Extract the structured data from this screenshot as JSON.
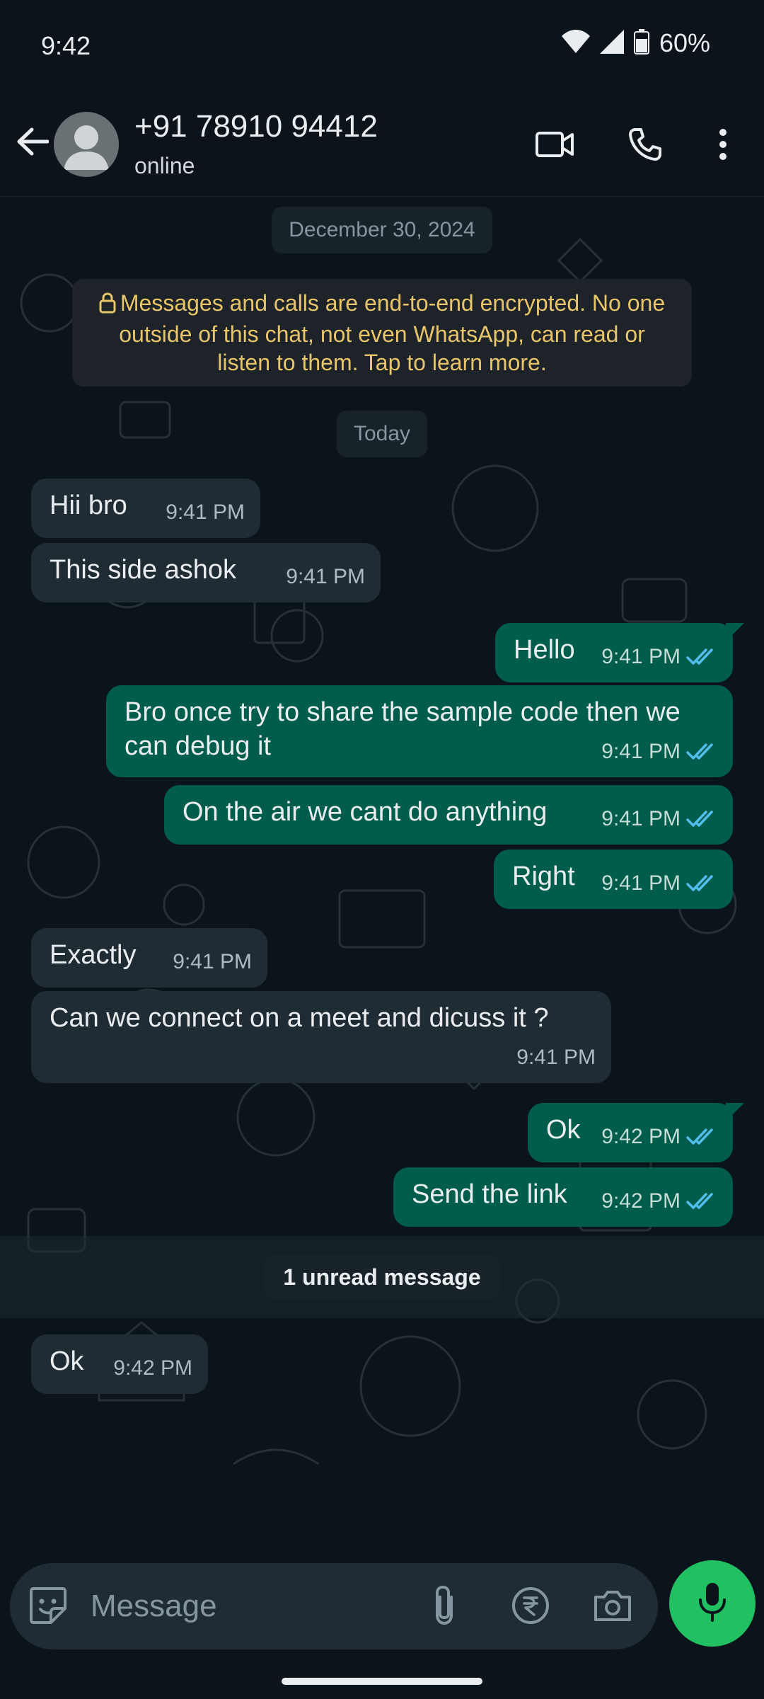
{
  "status_bar": {
    "time": "9:42",
    "battery": "60%"
  },
  "header": {
    "contact_name": "+91 78910 94412",
    "status": "online"
  },
  "chat": {
    "date_chip": "December 30, 2024",
    "encryption_notice": "Messages and calls are end-to-end encrypted. No one outside of this chat, not even WhatsApp, can read or listen to them. Tap to learn more.",
    "today_chip": "Today",
    "unread_label": "1 unread message",
    "messages": [
      {
        "dir": "in",
        "text": "Hii bro",
        "time": "9:41 PM"
      },
      {
        "dir": "in",
        "text": "This side ashok",
        "time": "9:41 PM"
      },
      {
        "dir": "out",
        "text": "Hello",
        "time": "9:41 PM"
      },
      {
        "dir": "out",
        "text": "Bro once try to share the sample code then we can debug it",
        "time": "9:41 PM"
      },
      {
        "dir": "out",
        "text": "On the air we cant do anything",
        "time": "9:41 PM"
      },
      {
        "dir": "out",
        "text": "Right",
        "time": "9:41 PM"
      },
      {
        "dir": "in",
        "text": "Exactly",
        "time": "9:41 PM"
      },
      {
        "dir": "in",
        "text": "Can we connect on a meet and dicuss it ?",
        "time": "9:41 PM"
      },
      {
        "dir": "out",
        "text": "Ok",
        "time": "9:42 PM"
      },
      {
        "dir": "out",
        "text": "Send the link",
        "time": "9:42 PM"
      },
      {
        "dir": "in",
        "text": "Ok",
        "time": "9:42 PM"
      }
    ]
  },
  "input": {
    "placeholder": "Message"
  },
  "colors": {
    "background": "#0b141a",
    "incoming_bubble": "#202c33",
    "outgoing_bubble": "#005c4b",
    "read_ticks": "#53bdeb",
    "accent_green": "#21c063",
    "encryption_text": "#e8c56a"
  },
  "icons": {
    "back": "arrow-left-icon",
    "video": "video-camera-icon",
    "call": "phone-icon",
    "menu": "more-vertical-icon",
    "sticker": "sticker-icon",
    "attach": "paperclip-icon",
    "payment": "rupee-icon",
    "camera": "camera-icon",
    "mic": "microphone-icon",
    "read": "double-check-icon"
  }
}
